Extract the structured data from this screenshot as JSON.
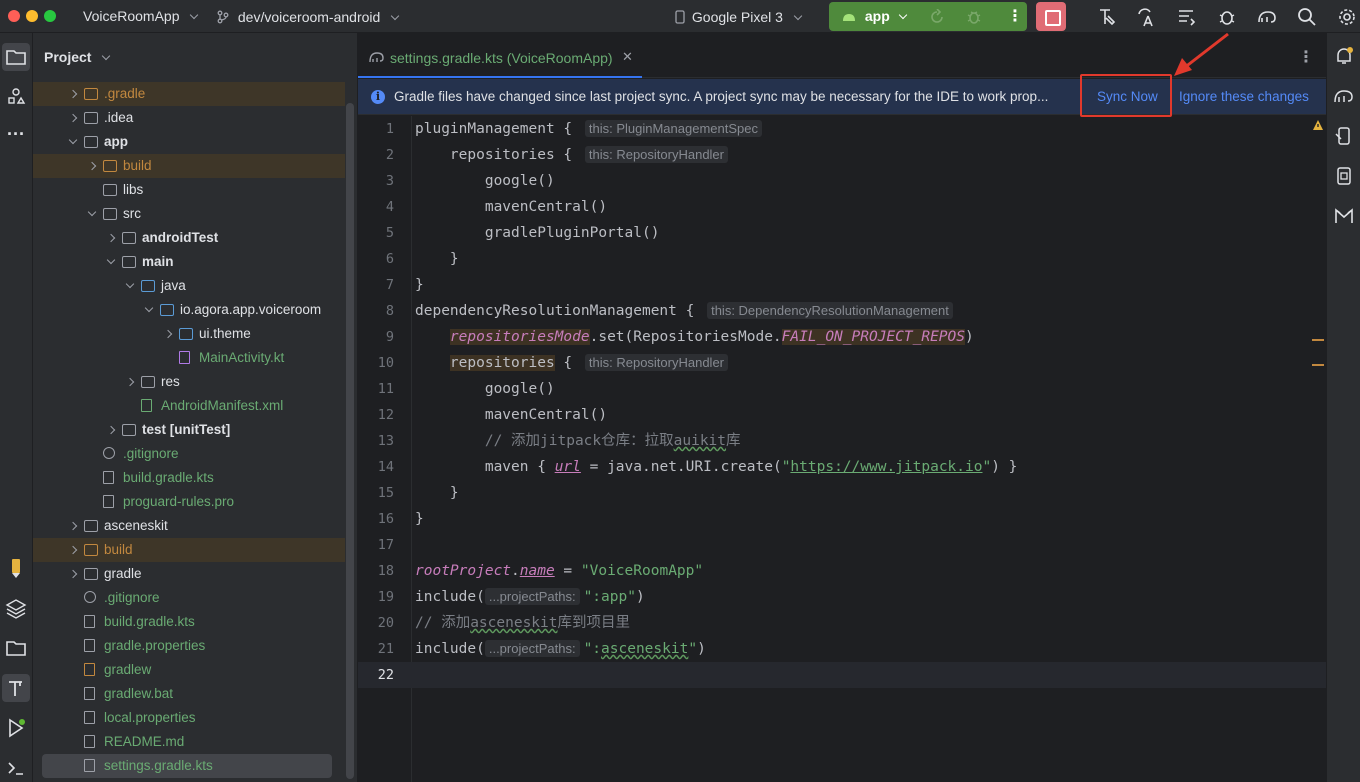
{
  "titlebar": {
    "project_name": "VoiceRoomApp",
    "branch": "dev/voiceroom-android",
    "device": "Google Pixel 3",
    "run_config": "app"
  },
  "project_panel": {
    "title": "Project",
    "tree": [
      {
        "label": ".gradle",
        "depth": 0,
        "arrow": "r",
        "icon": "folder",
        "color": "orange",
        "hl": true
      },
      {
        "label": ".idea",
        "depth": 0,
        "arrow": "r",
        "icon": "folder",
        "color": "white"
      },
      {
        "label": "app",
        "depth": 0,
        "arrow": "d",
        "icon": "module",
        "color": "white",
        "bold": true
      },
      {
        "label": "build",
        "depth": 1,
        "arrow": "r",
        "icon": "folder",
        "color": "orange",
        "hl": true
      },
      {
        "label": "libs",
        "depth": 1,
        "arrow": "",
        "icon": "folder",
        "color": "white"
      },
      {
        "label": "src",
        "depth": 1,
        "arrow": "d",
        "icon": "folder",
        "color": "white"
      },
      {
        "label": "androidTest",
        "depth": 2,
        "arrow": "r",
        "icon": "module",
        "color": "white",
        "bold": true
      },
      {
        "label": "main",
        "depth": 2,
        "arrow": "d",
        "icon": "module",
        "color": "white",
        "bold": true
      },
      {
        "label": "java",
        "depth": 3,
        "arrow": "d",
        "icon": "folder-blue",
        "color": "white"
      },
      {
        "label": "io.agora.app.voiceroom",
        "depth": 4,
        "arrow": "d",
        "icon": "package",
        "color": "white"
      },
      {
        "label": "ui.theme",
        "depth": 5,
        "arrow": "r",
        "icon": "package",
        "color": "white"
      },
      {
        "label": "MainActivity.kt",
        "depth": 5,
        "arrow": "",
        "icon": "kotlin",
        "color": "green"
      },
      {
        "label": "res",
        "depth": 3,
        "arrow": "r",
        "icon": "folder",
        "color": "white"
      },
      {
        "label": "AndroidManifest.xml",
        "depth": 3,
        "arrow": "",
        "icon": "manifest",
        "color": "green"
      },
      {
        "label": "test [unitTest]",
        "depth": 2,
        "arrow": "r",
        "icon": "module",
        "color": "white",
        "bold": true
      },
      {
        "label": ".gitignore",
        "depth": 1,
        "arrow": "",
        "icon": "ignore",
        "color": "green"
      },
      {
        "label": "build.gradle.kts",
        "depth": 1,
        "arrow": "",
        "icon": "gradle",
        "color": "green"
      },
      {
        "label": "proguard-rules.pro",
        "depth": 1,
        "arrow": "",
        "icon": "text",
        "color": "green"
      },
      {
        "label": "asceneskit",
        "depth": 0,
        "arrow": "r",
        "icon": "folder",
        "color": "white"
      },
      {
        "label": "build",
        "depth": 0,
        "arrow": "r",
        "icon": "folder",
        "color": "orange",
        "hl": true
      },
      {
        "label": "gradle",
        "depth": 0,
        "arrow": "r",
        "icon": "folder",
        "color": "white"
      },
      {
        "label": ".gitignore",
        "depth": 0,
        "arrow": "",
        "icon": "ignore",
        "color": "green"
      },
      {
        "label": "build.gradle.kts",
        "depth": 0,
        "arrow": "",
        "icon": "gradle",
        "color": "green"
      },
      {
        "label": "gradle.properties",
        "depth": 0,
        "arrow": "",
        "icon": "settings",
        "color": "green"
      },
      {
        "label": "gradlew",
        "depth": 0,
        "arrow": "",
        "icon": "shell",
        "color": "green"
      },
      {
        "label": "gradlew.bat",
        "depth": 0,
        "arrow": "",
        "icon": "text",
        "color": "green"
      },
      {
        "label": "local.properties",
        "depth": 0,
        "arrow": "",
        "icon": "settings",
        "color": "green"
      },
      {
        "label": "README.md",
        "depth": 0,
        "arrow": "",
        "icon": "markdown",
        "color": "green"
      },
      {
        "label": "settings.gradle.kts",
        "depth": 0,
        "arrow": "",
        "icon": "gradle",
        "color": "green",
        "selected": true
      }
    ]
  },
  "editor": {
    "tab_label": "settings.gradle.kts (VoiceRoomApp)",
    "notification": {
      "message": "Gradle files have changed since last project sync. A project sync may be necessary for the IDE to work prop...",
      "sync_now": "Sync Now",
      "ignore": "Ignore these changes"
    },
    "current_line": 22
  },
  "colors": {
    "accent": "#3574f0",
    "link": "#548af7",
    "callout": "#e1392c",
    "run_green": "#4f8a3c"
  }
}
